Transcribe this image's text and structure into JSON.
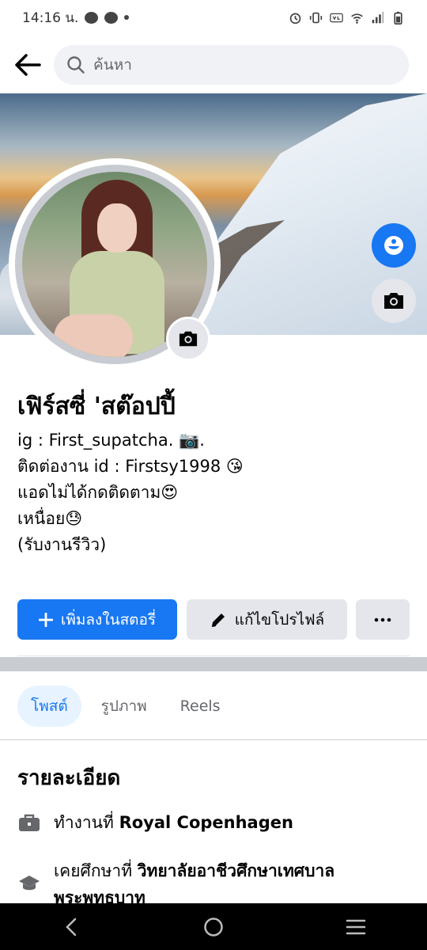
{
  "status_bar": {
    "time": "14:16 น.",
    "icons": [
      "messenger-icon",
      "chat-icon",
      "alarm-icon",
      "vibrate-icon",
      "volte-icon",
      "wifi-icon",
      "signal-icon",
      "battery-icon"
    ]
  },
  "header": {
    "search_placeholder": "ค้นหา"
  },
  "profile": {
    "name": "เฟิร์สซี่ 'สต๊อปปี้",
    "bio": [
      "ig : First_supatcha. 📷.",
      "ติดต่องาน id : Firstsy1998 😘",
      "แอดไม่ได้กดติดตาม😍",
      "เหนื่อย😓",
      "(รับงานรีวิว)"
    ]
  },
  "actions": {
    "add_story": "เพิ่มลงในสตอรี่",
    "edit_profile": "แก้ไขโปรไฟล์"
  },
  "tabs": [
    {
      "label": "โพสต์",
      "active": true
    },
    {
      "label": "รูปภาพ",
      "active": false
    },
    {
      "label": "Reels",
      "active": false
    }
  ],
  "details": {
    "title": "รายละเอียด",
    "work_prefix": "ทำงานที่ ",
    "work_place": "Royal Copenhagen",
    "edu_prefix": "เคยศึกษาที่ ",
    "edu_place": "วิทยาลัยอาชีวศึกษาเทศบาลพระพุทธบาท"
  },
  "colors": {
    "accent": "#1877f2",
    "secondary_button": "#e4e6eb",
    "active_tab_bg": "#e7f3ff",
    "muted_text": "#65676b"
  }
}
